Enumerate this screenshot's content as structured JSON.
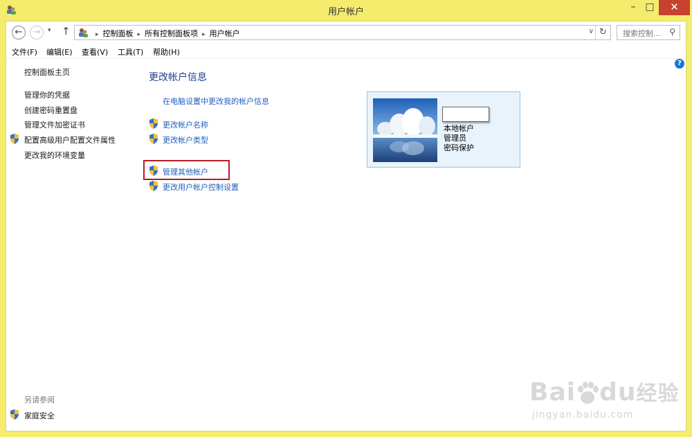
{
  "window": {
    "title": "用户帐户",
    "min_glyph": "–",
    "max_glyph": "□",
    "close_glyph": "✕"
  },
  "nav": {
    "back_glyph": "←",
    "forward_glyph": "→",
    "dropdown_glyph": "▾",
    "up_glyph": "↑",
    "breadcrumbs": [
      "控制面板",
      "所有控制面板项",
      "用户帐户"
    ],
    "breadcrumb_sep": "▸",
    "address_drop_glyph": "∨",
    "refresh_glyph": "↻",
    "search_placeholder": "搜索控制...",
    "search_glyph": "⚲"
  },
  "menu": {
    "items": [
      "文件(F)",
      "编辑(E)",
      "查看(V)",
      "工具(T)",
      "帮助(H)"
    ]
  },
  "help": {
    "glyph": "?"
  },
  "sidebar": {
    "home": "控制面板主页",
    "links": [
      "管理你的凭据",
      "创建密码重置盘",
      "管理文件加密证书",
      "配置高级用户配置文件属性",
      "更改我的环境变量"
    ],
    "see_also_heading": "另请参阅",
    "see_also_links": [
      "家庭安全"
    ]
  },
  "main": {
    "title": "更改帐户信息",
    "pc_settings_link": "在电脑设置中更改我的帐户信息",
    "links": [
      "更改帐户名称",
      "更改帐户类型"
    ],
    "other_links": [
      "管理其他帐户",
      "更改用户帐户控制设置"
    ]
  },
  "account": {
    "name": "",
    "type": "本地帐户",
    "role": "管理员",
    "protection": "密码保护"
  },
  "watermark": {
    "text_main": "Bai",
    "text_du": "du",
    "text_cn": "经验",
    "url": "jingyan.baidu.com"
  },
  "colors": {
    "frame": "#f5ec6e",
    "link": "#1f5fba",
    "heading": "#1e3f93",
    "highlight_border": "#b31c22",
    "close_button": "#c7412c"
  }
}
